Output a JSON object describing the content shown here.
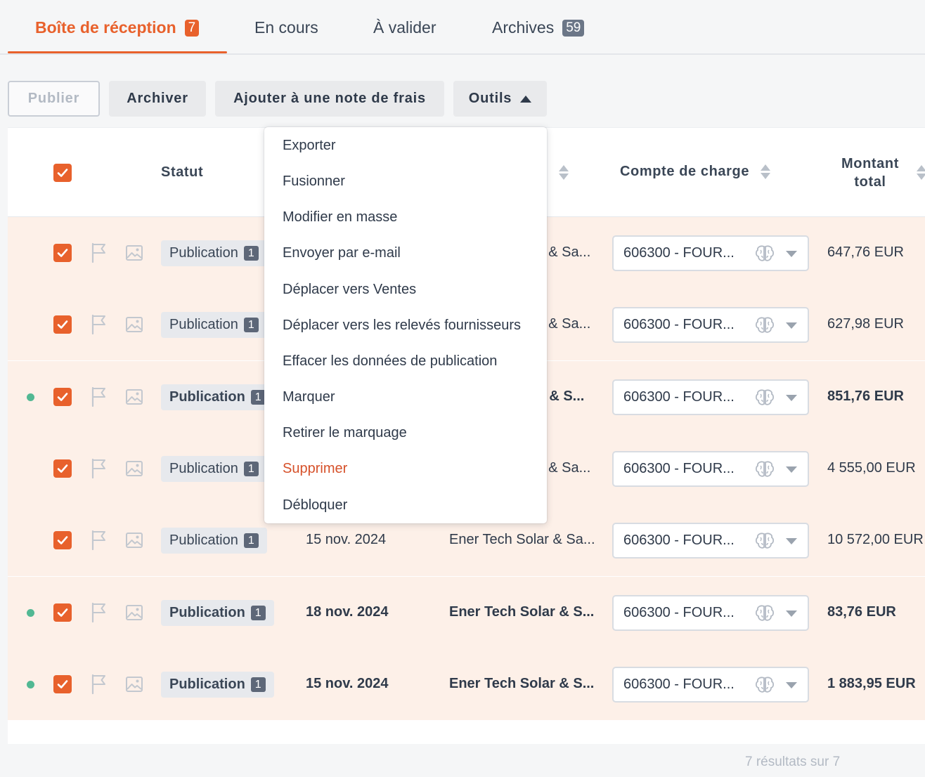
{
  "tabs": [
    {
      "label": "Boîte de réception",
      "badge": "7"
    },
    {
      "label": "En cours"
    },
    {
      "label": "À valider"
    },
    {
      "label": "Archives",
      "badge": "59"
    }
  ],
  "toolbar": {
    "publish": "Publier",
    "archive": "Archiver",
    "add_expense": "Ajouter à une note de frais",
    "tools": "Outils"
  },
  "menu": {
    "items": [
      "Exporter",
      "Fusionner",
      "Modifier en masse",
      "Envoyer par e-mail",
      "Déplacer vers Ventes",
      "Déplacer vers les relevés fournisseurs",
      "Effacer les données de publication",
      "Marquer",
      "Retirer le marquage",
      "Supprimer",
      "Débloquer"
    ]
  },
  "table": {
    "headers": {
      "status": "Statut",
      "expense_account": "Compte de charge",
      "total_line1": "Montant",
      "total_line2": "total"
    },
    "rows": [
      {
        "status": "Publication",
        "count": "1",
        "date": "",
        "supplier": "r & Sa...",
        "account": "606300 - FOUR...",
        "amount": "647,76 EUR",
        "bold": false,
        "dot": false
      },
      {
        "status": "Publication",
        "count": "1",
        "date": "",
        "supplier": "r & Sa...",
        "account": "606300 - FOUR...",
        "amount": "627,98 EUR",
        "bold": false,
        "dot": false
      },
      {
        "status": "Publication",
        "count": "1",
        "date": "",
        "supplier": "r & S...",
        "account": "606300 - FOUR...",
        "amount": "851,76 EUR",
        "bold": true,
        "dot": true
      },
      {
        "status": "Publication",
        "count": "1",
        "date": "",
        "supplier": "r & Sa...",
        "account": "606300 - FOUR...",
        "amount": "4 555,00 EUR",
        "bold": false,
        "dot": false
      },
      {
        "status": "Publication",
        "count": "1",
        "date": "15 nov. 2024",
        "supplier": "Ener Tech Solar & Sa...",
        "account": "606300 - FOUR...",
        "amount": "10 572,00 EUR",
        "bold": false,
        "dot": false
      },
      {
        "status": "Publication",
        "count": "1",
        "date": "18 nov. 2024",
        "supplier": "Ener Tech Solar & S...",
        "account": "606300 - FOUR...",
        "amount": "83,76 EUR",
        "bold": true,
        "dot": true
      },
      {
        "status": "Publication",
        "count": "1",
        "date": "15 nov. 2024",
        "supplier": "Ener Tech Solar & S...",
        "account": "606300 - FOUR...",
        "amount": "1 883,95 EUR",
        "bold": true,
        "dot": true
      }
    ]
  },
  "footer": {
    "results": "7 résultats sur 7"
  },
  "colors": {
    "accent": "#e8612c",
    "row_bg": "#fdf0e8",
    "dot": "#52b893",
    "danger": "#d6512a"
  }
}
